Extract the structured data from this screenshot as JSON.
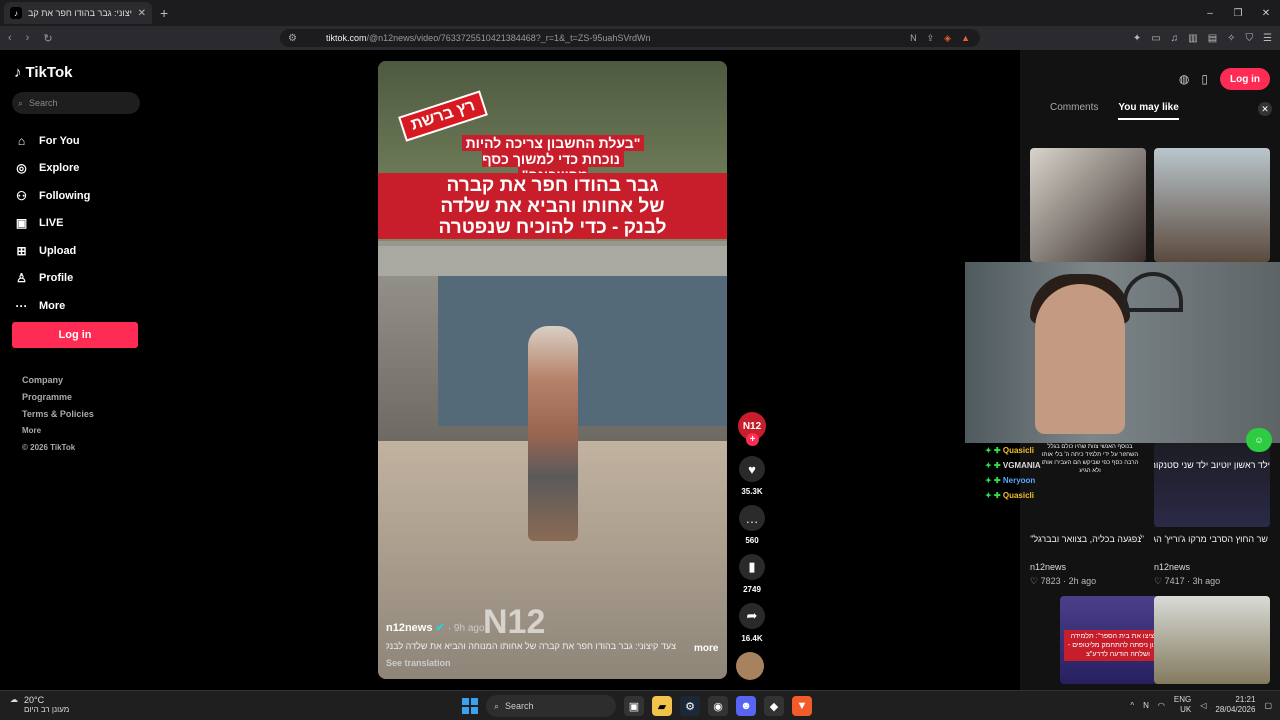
{
  "browser": {
    "tab_title": "צעד קיצוני: גבר בהודו חפר את קב",
    "tab_close": "✕",
    "new_tab": "+",
    "url_host": "tiktok.com",
    "url_rest": "/@n12news/video/7633725510421384468?_r=1&_t=ZS-95uahSVrdWn"
  },
  "sidebar": {
    "logo": "TikTok",
    "search_placeholder": "Search",
    "items": [
      {
        "label": "For You",
        "icon": "⌂"
      },
      {
        "label": "Explore",
        "icon": "◎"
      },
      {
        "label": "Following",
        "icon": "⚇"
      },
      {
        "label": "LIVE",
        "icon": "▣"
      },
      {
        "label": "Upload",
        "icon": "⊞"
      },
      {
        "label": "Profile",
        "icon": "♙"
      },
      {
        "label": "More",
        "icon": "···"
      }
    ],
    "login": "Log in",
    "footer": [
      "Company",
      "Programme",
      "Terms & Policies"
    ],
    "footer_more": "More",
    "copyright": "© 2026 TikTok"
  },
  "video": {
    "tag": "רץ ברשת",
    "quote_line1": "\"בעלת החשבון צריכה להיות",
    "quote_line2": "נוכחת כדי למשוך כסף מחשבונה\"",
    "headline_line1": "גבר בהודו חפר את קברה",
    "headline_line2": "של אחותו והביא את שלדה",
    "headline_line3": "לבנק - כדי להוכיח שנפטרה",
    "watermark": "N12",
    "author": "n12news",
    "time": "· 9h ago",
    "caption": "צעד קיצוני: גבר בהודו חפר את קברה של אחותו המנוחה והביא את שלדה לבנק",
    "more": "more",
    "see_translation": "See translation"
  },
  "actions": {
    "avatar": "N12",
    "likes": "35.3K",
    "comments": "560",
    "saves": "2749",
    "shares": "16.4K"
  },
  "panel": {
    "login": "Log in",
    "tab_comments": "Comments",
    "tab_like": "You may like",
    "cards": [
      {
        "title": "\"נפגעה בכליה, בצוואר ובברגל\": תלמיד כיתה ה'",
        "author": "n12news",
        "likes": "7823",
        "age": "2h ago"
      },
      {
        "title": "שר החוץ הסרבי מרקו ג'וריץ' הגיע לביקור בישראל ופתח",
        "author": "n12news",
        "likes": "7417",
        "age": "3h ago"
      }
    ],
    "card_label_3": "\"הפציצו את בית הספר\": תלמידה בלבנון ניסתה להתחמק מליטופים - ושלחה הודעה לדרע\"צ",
    "card4_title": "ילד ראשון יוטיוב ילד שני סטנקות"
  },
  "stream_chat": [
    {
      "name": "Quasicli",
      "cls": "y"
    },
    {
      "name": "VGMANIA",
      "cls": "w"
    },
    {
      "name": "Neryoon",
      "cls": "b"
    },
    {
      "name": "Quasicli",
      "cls": "y"
    }
  ],
  "stream_dup_text": "בנוסף האנשי צוות שהיו כולם בגלל השחזור על ידי תלמיד כיתה ה' בלי אותו הרבה כסף כפי שביקש הם העבירו אותו ולא הגיע",
  "taskbar": {
    "temp": "20°C",
    "weather_text": "מעונן רב היום",
    "search": "Search",
    "lang_top": "ENG",
    "lang_bottom": "UK",
    "time": "21:21",
    "date": "28/04/2026"
  }
}
